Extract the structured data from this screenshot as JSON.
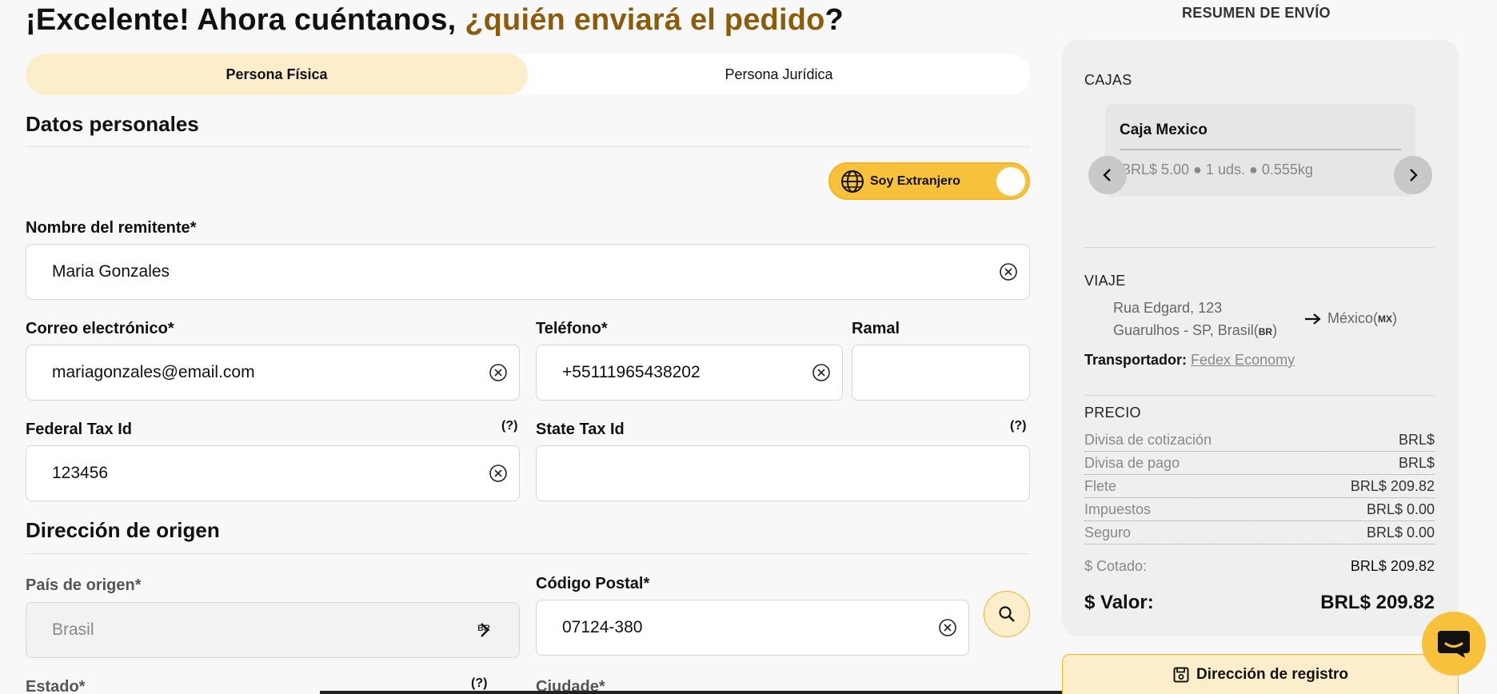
{
  "headline": {
    "part1": "¡Excelente! Ahora cuéntanos, ",
    "accent": "¿quién enviará el pedido",
    "part2": "?"
  },
  "tabs": [
    {
      "label": "Persona Física",
      "active": true
    },
    {
      "label": "Persona Jurídica",
      "active": false
    }
  ],
  "sections": {
    "personal": "Datos personales",
    "origin": "Dirección de origen"
  },
  "toggle": {
    "label": "Soy Extranjero",
    "on": true
  },
  "form": {
    "sender_name": {
      "label": "Nombre del remitente*",
      "value": "Maria Gonzales"
    },
    "email": {
      "label": "Correo electrónico*",
      "value": "mariagonzales@email.com"
    },
    "phone": {
      "label": "Teléfono*",
      "value": "+55111965438202"
    },
    "ramal": {
      "label": "Ramal",
      "value": ""
    },
    "federal_tax": {
      "label": "Federal Tax Id",
      "help": "(?)",
      "value": "123456"
    },
    "state_tax": {
      "label": "State Tax Id",
      "help": "(?)",
      "value": ""
    },
    "country": {
      "label": "País de origen*",
      "value": "Brasil",
      "code": "BR"
    },
    "postal": {
      "label": "Código Postal*",
      "value": "07124-380"
    },
    "state": {
      "label": "Estado*",
      "help": "(?)"
    },
    "city": {
      "label": "Ciudade*"
    }
  },
  "summary": {
    "heading": "RESUMEN DE ENVÍO",
    "boxes_title": "CAJAS",
    "box": {
      "name": "Caja Mexico",
      "info": "BRL$ 5.00 ● 1 uds. ● 0.555kg"
    },
    "trip_title": "VIAJE",
    "trip": {
      "origin_line1": "Rua Edgard, 123",
      "origin_line2": "Guarulhos - SP, Brasil(",
      "origin_code": "BR",
      "origin_close": ")",
      "dest": "México(",
      "dest_code": "MX",
      "dest_close": ")"
    },
    "carrier_label": "Transportador:",
    "carrier": "Fedex Economy",
    "price_title": "PRECIO",
    "prices": [
      {
        "k": "Divisa de cotización",
        "v": "BRL$"
      },
      {
        "k": "Divisa de pago",
        "v": "BRL$"
      },
      {
        "k": "Flete",
        "v": "BRL$ 209.82"
      },
      {
        "k": "Impuestos",
        "v": "BRL$ 0.00"
      },
      {
        "k": "Seguro",
        "v": "BRL$ 0.00"
      }
    ],
    "quoted": {
      "k": "$ Cotado:",
      "v": "BRL$ 209.82"
    },
    "total": {
      "k": "$ Valor:",
      "v": "BRL$ 209.82"
    },
    "register_button": "Dirección de registro"
  },
  "colors": {
    "accent": "#8a5c0c",
    "yellow": "#f7c13b",
    "cream": "#fdeecb"
  },
  "icons": [
    "globe-icon",
    "clear-icon",
    "search-icon",
    "chevron-left-icon",
    "chevron-right-icon",
    "arrow-right-icon",
    "save-icon",
    "chat-icon"
  ]
}
